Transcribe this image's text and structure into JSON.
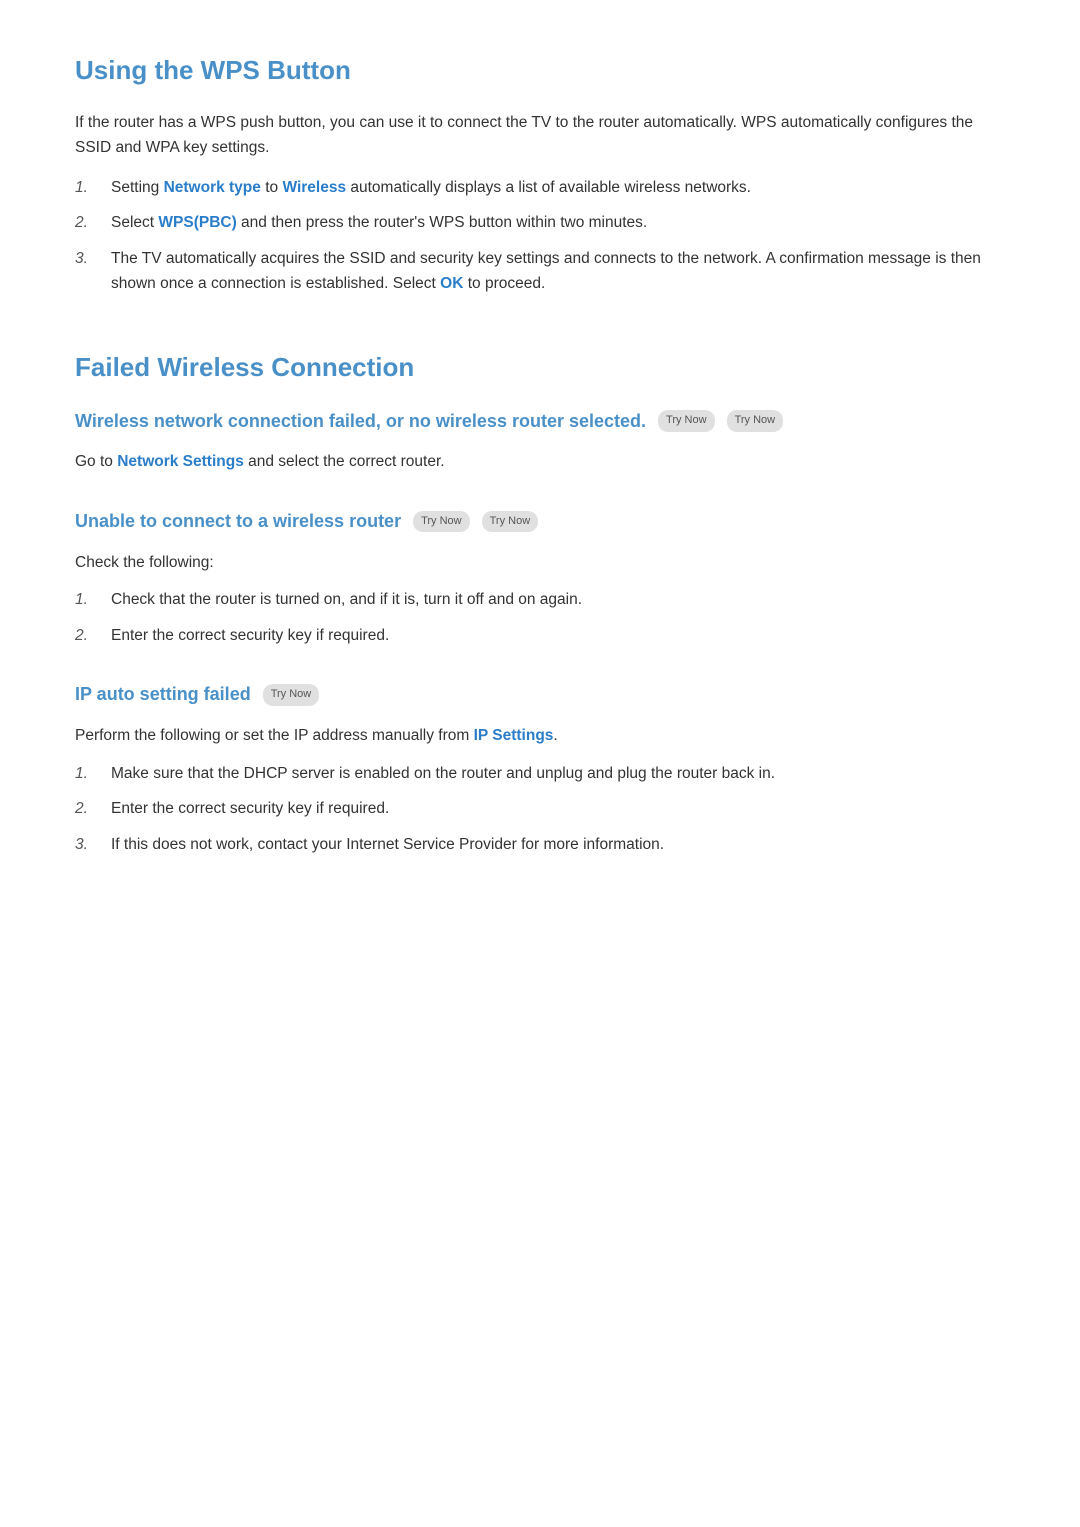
{
  "wps": {
    "title": "Using the WPS Button",
    "intro": "If the router has a WPS push button, you can use it to connect the TV to the router automatically. WPS automatically configures the SSID and WPA key settings.",
    "steps": [
      {
        "number": "1.",
        "text_parts": [
          {
            "text": "Setting ",
            "highlight": false
          },
          {
            "text": "Network type",
            "highlight": true
          },
          {
            "text": " to ",
            "highlight": false
          },
          {
            "text": "Wireless",
            "highlight": true
          },
          {
            "text": " automatically displays a list of available wireless networks.",
            "highlight": false
          }
        ]
      },
      {
        "number": "2.",
        "text_parts": [
          {
            "text": "Select ",
            "highlight": false
          },
          {
            "text": "WPS(PBC)",
            "highlight": true
          },
          {
            "text": " and then press the router's WPS button within two minutes.",
            "highlight": false
          }
        ]
      },
      {
        "number": "3.",
        "text_parts": [
          {
            "text": "The TV automatically acquires the SSID and security key settings and connects to the network. A confirmation message is then shown once a connection is established. Select ",
            "highlight": false
          },
          {
            "text": "OK",
            "highlight": true
          },
          {
            "text": " to proceed.",
            "highlight": false
          }
        ]
      }
    ]
  },
  "failed": {
    "title": "Failed Wireless Connection",
    "subsections": [
      {
        "id": "wireless-failed",
        "title": "Wireless network connection failed, or no wireless router selected.",
        "try_now_count": 2,
        "body": "Go to {Network Settings} and select the correct router.",
        "body_parts": [
          {
            "text": "Go to ",
            "highlight": false
          },
          {
            "text": "Network Settings",
            "highlight": true
          },
          {
            "text": " and select the correct router.",
            "highlight": false
          }
        ],
        "has_list": false
      },
      {
        "id": "unable-connect",
        "title": "Unable to connect to a wireless router",
        "try_now_count": 2,
        "intro": "Check the following:",
        "has_list": true,
        "steps": [
          {
            "number": "1.",
            "text": "Check that the router is turned on, and if it is, turn it off and on again."
          },
          {
            "number": "2.",
            "text": "Enter the correct security key if required."
          }
        ]
      },
      {
        "id": "ip-auto-setting",
        "title": "IP auto setting failed",
        "try_now_count": 1,
        "body_parts": [
          {
            "text": "Perform the following or set the IP address manually from ",
            "highlight": false
          },
          {
            "text": "IP Settings",
            "highlight": true
          },
          {
            "text": ".",
            "highlight": false
          }
        ],
        "has_list": true,
        "steps": [
          {
            "number": "1.",
            "text": "Make sure that the DHCP server is enabled on the router and unplug and plug the router back in."
          },
          {
            "number": "2.",
            "text": "Enter the correct security key if required."
          },
          {
            "number": "3.",
            "text": "If this does not work, contact your Internet Service Provider for more information."
          }
        ]
      }
    ]
  },
  "labels": {
    "try_now": "Try Now",
    "check_following": "Check the following:"
  }
}
